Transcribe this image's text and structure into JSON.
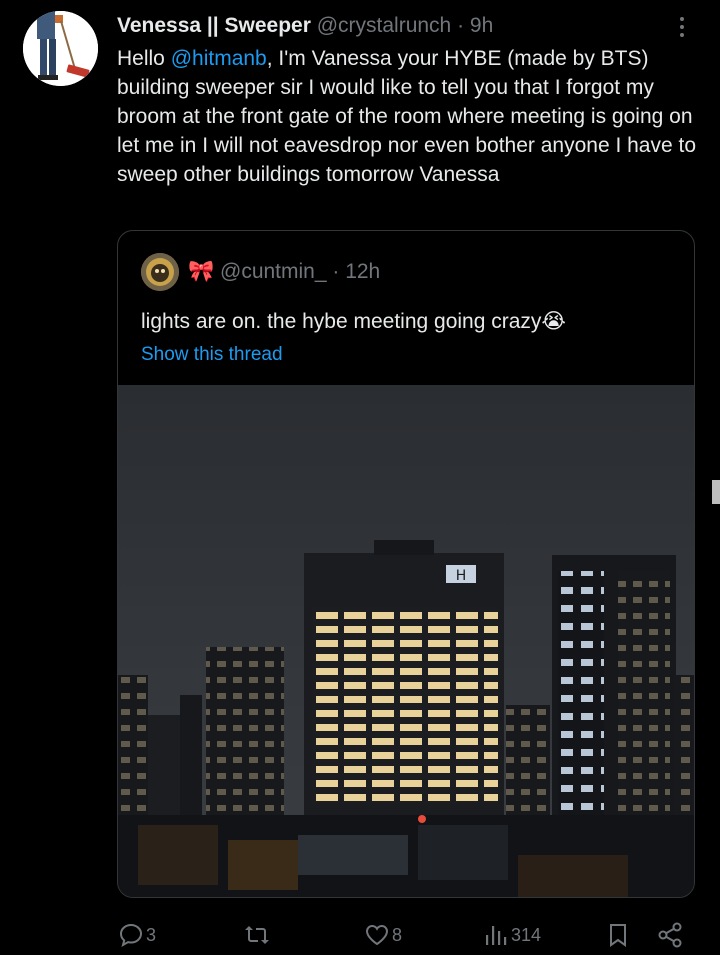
{
  "tweet": {
    "display_name": "Venessa || Sweeper",
    "handle": "@crystalrunch",
    "time": "· 9h",
    "text_before_mention": "Hello ",
    "mention": "@hitmanb",
    "text_after_mention": ", I'm Vanessa your HYBE (made by BTS) building sweeper sir I would like to tell you that I forgot my broom at the front gate of the room where meeting is going on let me in I will not eavesdrop nor even bother anyone I have to sweep other buildings tomorrow Vanessa"
  },
  "quote": {
    "emoji": "🎀",
    "handle": "@cuntmin_",
    "time": "· 12h",
    "text": "lights are on. the hybe meeting going crazy",
    "text_emoji": "😭",
    "show_thread": "Show this thread",
    "photo_building_sign": "H"
  },
  "actions": {
    "replies": "3",
    "retweets": "",
    "likes": "8",
    "views": "314"
  },
  "colors": {
    "background": "#000000",
    "text": "#e7e9ea",
    "muted": "#71767b",
    "link": "#1d9bf0"
  },
  "icons": [
    "more-icon",
    "reply-icon",
    "retweet-icon",
    "like-icon",
    "views-icon",
    "bookmark-icon",
    "share-icon"
  ]
}
